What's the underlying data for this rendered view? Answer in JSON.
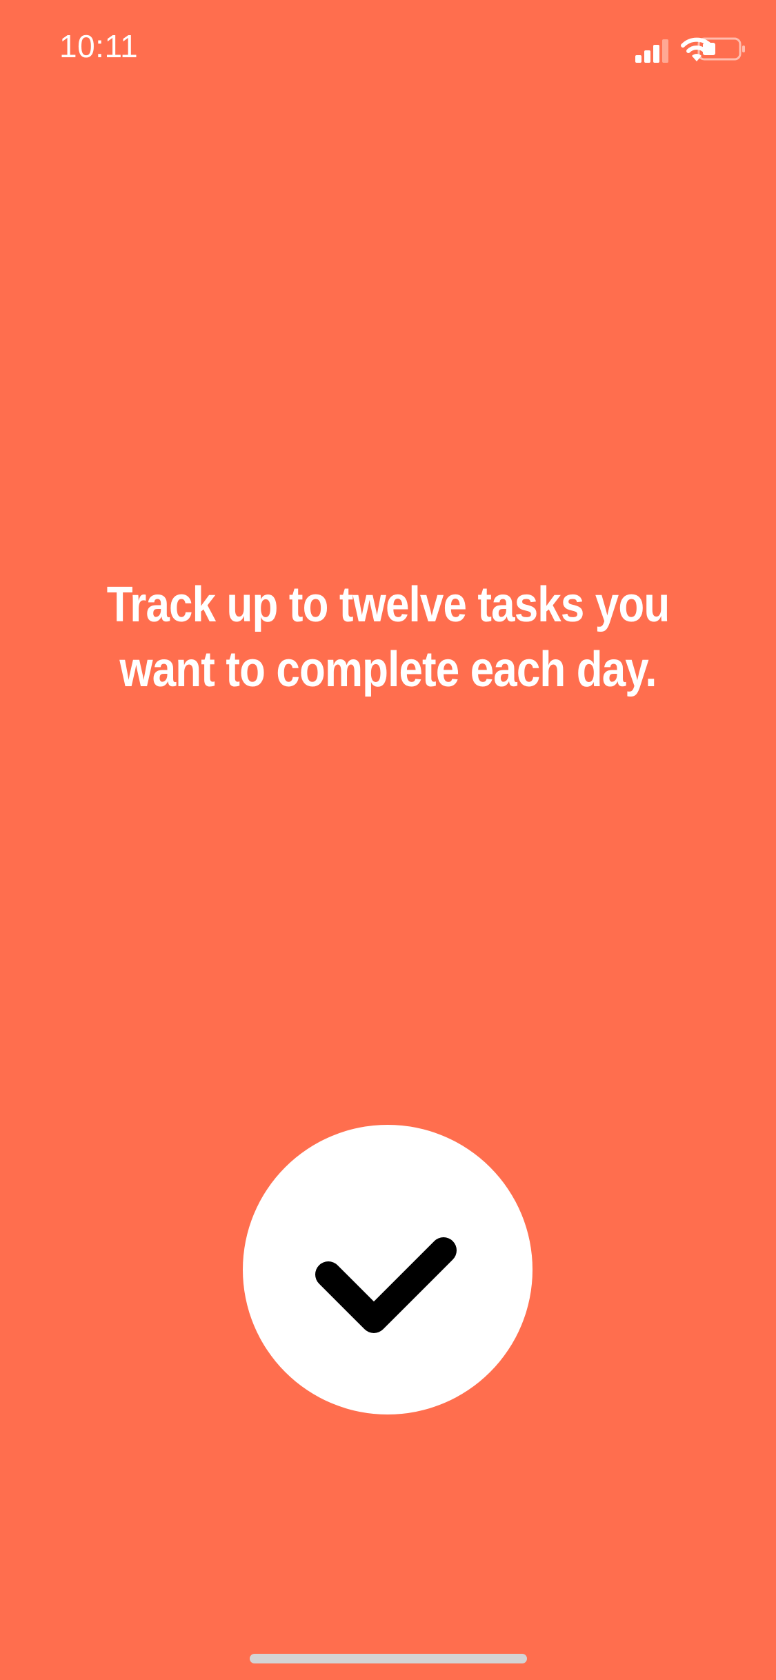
{
  "status_bar": {
    "time": "10:11",
    "icons": [
      "cellular-signal-icon",
      "wifi-icon",
      "battery-icon"
    ]
  },
  "onboarding": {
    "message": "Track up to twelve tasks you want to complete each day."
  },
  "check_button": {
    "icon": "checkmark-icon"
  },
  "colors": {
    "background": "#FF6E4E",
    "text": "#FFFFFF",
    "button": "#FFFFFF",
    "icon": "#000000",
    "home_indicator": "#D4D4D4"
  }
}
